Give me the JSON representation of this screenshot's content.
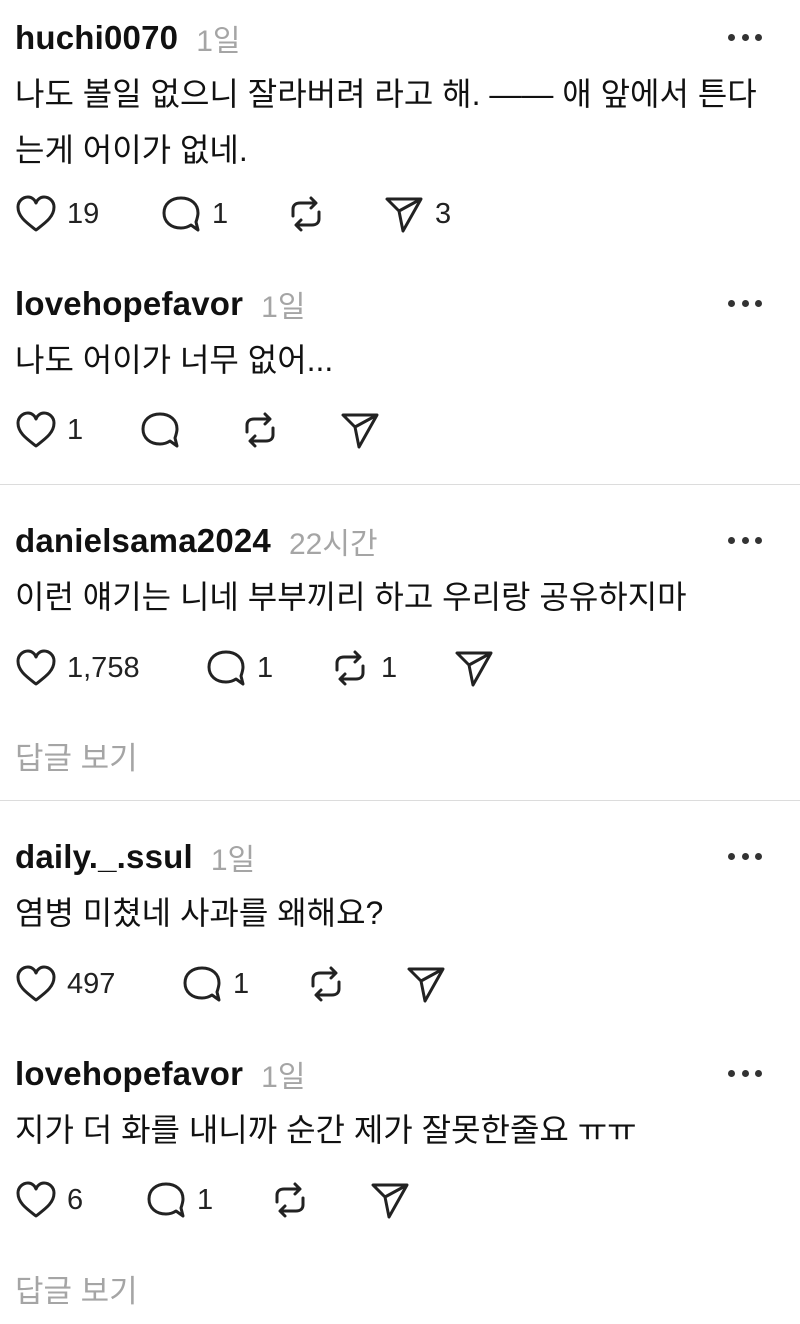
{
  "posts": [
    {
      "username": "huchi0070",
      "time": "1일",
      "text": "나도 볼일 없으니 잘라버려 라고 해. —— 애 앞에서 튼다는게 어이가 없네.",
      "likes": "19",
      "comments": "1",
      "reposts": "",
      "shares": "3"
    },
    {
      "username": "lovehopefavor",
      "time": "1일",
      "text": "나도 어이가 너무 없어...",
      "likes": "1",
      "comments": "",
      "reposts": "",
      "shares": ""
    },
    {
      "username": "danielsama2024",
      "time": "22시간",
      "text": "이런 얘기는 니네 부부끼리 하고 우리랑 공유하지마",
      "likes": "1,758",
      "comments": "1",
      "reposts": "1",
      "shares": ""
    },
    {
      "username": "daily._.ssul",
      "time": "1일",
      "text": "염병 미쳤네 사과를 왜해요?",
      "likes": "497",
      "comments": "1",
      "reposts": "",
      "shares": ""
    },
    {
      "username": "lovehopefavor",
      "time": "1일",
      "text": "지가 더 화를 내니까 순간 제가 잘못한줄요 ㅠㅠ",
      "likes": "6",
      "comments": "1",
      "reposts": "",
      "shares": ""
    }
  ],
  "view_replies_label": "답글 보기",
  "icons": {
    "like": "heart-icon",
    "comment": "comment-bubble-icon",
    "repost": "repost-icon",
    "share": "send-icon",
    "more": "more-dots-icon"
  }
}
